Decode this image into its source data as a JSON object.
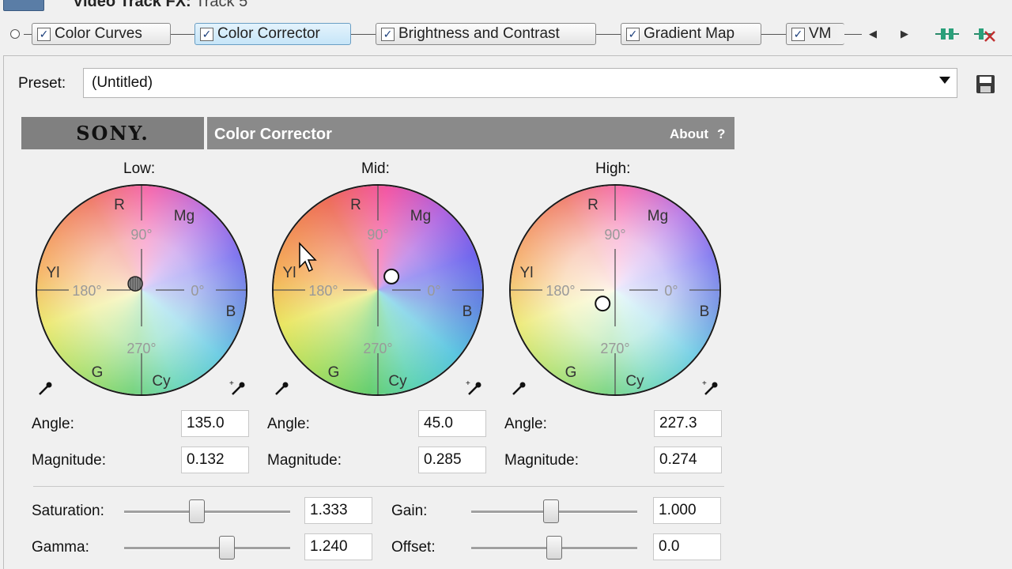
{
  "window": {
    "title": "Video Track FX:",
    "subtitle": "Track 5"
  },
  "fx_chain": [
    {
      "label": "Color Curves",
      "checked": true,
      "active": false
    },
    {
      "label": "Color Corrector",
      "checked": true,
      "active": true
    },
    {
      "label": "Brightness and Contrast",
      "checked": true,
      "active": false
    },
    {
      "label": "Gradient Map",
      "checked": true,
      "active": false
    },
    {
      "label": "VM",
      "checked": true,
      "active": false
    }
  ],
  "preset": {
    "label": "Preset:",
    "value": "(Untitled)"
  },
  "plugin": {
    "brand": "SONY.",
    "title": "Color Corrector",
    "about": "About",
    "help": "?"
  },
  "wheel_markers": {
    "r": "R",
    "mg": "Mg",
    "yl": "Yl",
    "b": "B",
    "g": "G",
    "cy": "Cy",
    "deg90": "90°",
    "deg180": "180°",
    "deg0": "0°",
    "deg270": "270°"
  },
  "wheels": [
    {
      "name": "Low:",
      "angle": "135.0",
      "magnitude": "0.132"
    },
    {
      "name": "Mid:",
      "angle": "45.0",
      "magnitude": "0.285"
    },
    {
      "name": "High:",
      "angle": "227.3",
      "magnitude": "0.274"
    }
  ],
  "field_labels": {
    "angle": "Angle:",
    "magnitude": "Magnitude:"
  },
  "sliders": {
    "saturation": {
      "label": "Saturation:",
      "value": "1.333",
      "level": 0.44
    },
    "gamma": {
      "label": "Gamma:",
      "value": "1.240",
      "level": 0.62
    },
    "gain": {
      "label": "Gain:",
      "value": "1.000",
      "level": 0.48
    },
    "offset": {
      "label": "Offset:",
      "value": "0.0",
      "level": 0.5
    }
  },
  "colors": {
    "active_tab": "#c6e5f8",
    "header_gray": "#8a8a8a"
  }
}
